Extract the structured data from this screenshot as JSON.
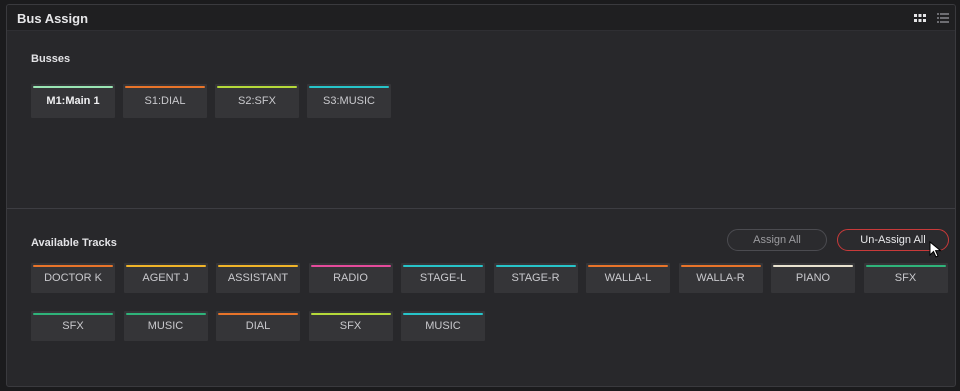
{
  "window": {
    "title": "Bus Assign",
    "view_icons": [
      "grid-view-icon",
      "list-view-icon"
    ]
  },
  "busses": {
    "label": "Busses",
    "items": [
      {
        "label": "M1:Main 1",
        "color": "#9ae6b4",
        "selected": true
      },
      {
        "label": "S1:DIAL",
        "color": "#e8742a"
      },
      {
        "label": "S2:SFX",
        "color": "#b5d93a"
      },
      {
        "label": "S3:MUSIC",
        "color": "#27c4c9"
      }
    ]
  },
  "tracks": {
    "label": "Available Tracks",
    "assign_all_label": "Assign All",
    "unassign_all_label": "Un-Assign All",
    "items": [
      {
        "label": "DOCTOR K",
        "color": "#e8742a"
      },
      {
        "label": "AGENT J",
        "color": "#f0b429"
      },
      {
        "label": "ASSISTANT",
        "color": "#f0b429"
      },
      {
        "label": "RADIO",
        "color": "#e54b9b"
      },
      {
        "label": "STAGE-L",
        "color": "#27c4c9"
      },
      {
        "label": "STAGE-R",
        "color": "#27c4c9"
      },
      {
        "label": "WALLA-L",
        "color": "#e8742a"
      },
      {
        "label": "WALLA-R",
        "color": "#e8742a"
      },
      {
        "label": "PIANO",
        "color": "#e9e2cf"
      },
      {
        "label": "SFX",
        "color": "#2fb37a"
      },
      {
        "label": "SFX",
        "color": "#2fb37a"
      },
      {
        "label": "MUSIC",
        "color": "#2fb37a"
      },
      {
        "label": "DIAL",
        "color": "#e8742a"
      },
      {
        "label": "SFX",
        "color": "#b5d93a"
      },
      {
        "label": "MUSIC",
        "color": "#27c4c9"
      }
    ]
  }
}
